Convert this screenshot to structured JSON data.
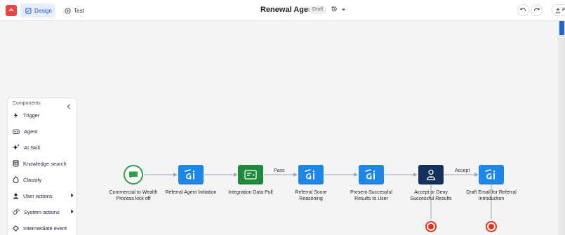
{
  "header": {
    "tab_design": "Design",
    "tab_test": "Test",
    "title": "Renewal Agent",
    "status": "Draft",
    "publish_label": "P"
  },
  "panel": {
    "title": "Components",
    "items": [
      {
        "label": "Trigger",
        "icon": "lightning-icon",
        "submenu": false
      },
      {
        "label": "Agent",
        "icon": "agent-icon",
        "submenu": false
      },
      {
        "label": "AI Skill",
        "icon": "sparkle-icon",
        "submenu": false
      },
      {
        "label": "Knowledge search",
        "icon": "database-icon",
        "submenu": false
      },
      {
        "label": "Classify",
        "icon": "classify-icon",
        "submenu": false
      },
      {
        "label": "User actions",
        "icon": "user-icon",
        "submenu": true
      },
      {
        "label": "System actions",
        "icon": "gears-icon",
        "submenu": true
      },
      {
        "label": "Intermediate event",
        "icon": "diamond-icon",
        "submenu": false
      }
    ]
  },
  "flow": {
    "nodes": [
      {
        "id": "start",
        "type": "start",
        "label": "Commercial to Wealth Process kick off"
      },
      {
        "id": "n1",
        "type": "ai",
        "label": "Referral Agent Initiation"
      },
      {
        "id": "n2",
        "type": "integration",
        "label": "Integration Data Pull"
      },
      {
        "id": "n3",
        "type": "ai",
        "label": "Referral Score Reasoning"
      },
      {
        "id": "n4",
        "type": "ai",
        "label": "Present Successful Results to User"
      },
      {
        "id": "n5",
        "type": "human",
        "label": "Accept or Deny Successful Results"
      },
      {
        "id": "n6",
        "type": "ai",
        "label": "Draft Email for Referral Introduction"
      }
    ],
    "edge_labels": {
      "pass": "Pass",
      "accept": "Accept"
    },
    "colors": {
      "ai": "#1e86e6",
      "integration": "#1f8a3d",
      "human": "#14305c",
      "start": "#2ea043",
      "end": "#e5331b",
      "edge": "#9aa8bd"
    }
  }
}
